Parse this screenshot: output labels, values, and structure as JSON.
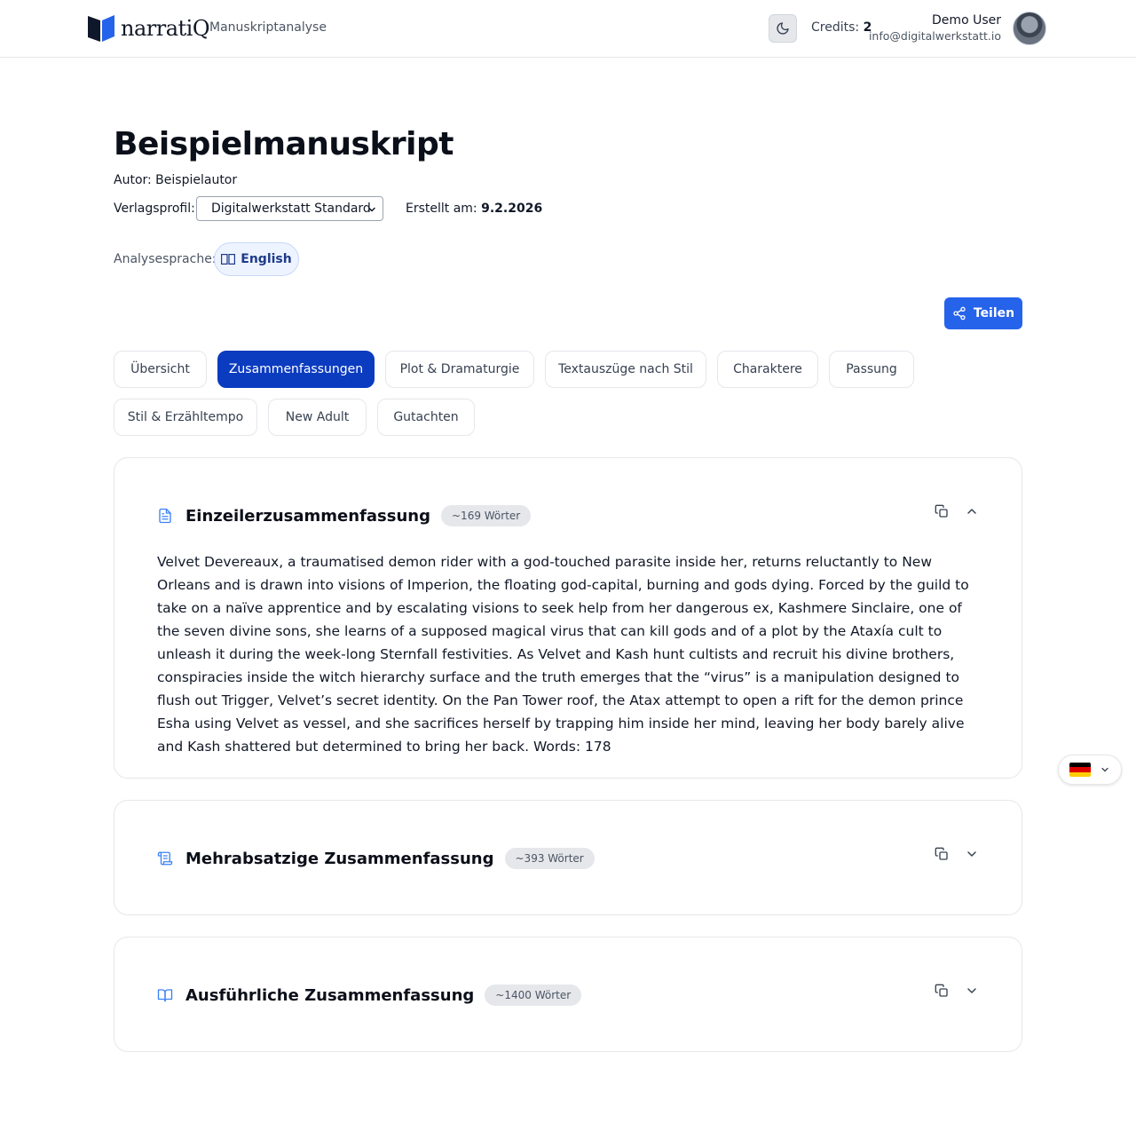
{
  "header": {
    "brand": "narratiQ",
    "subtitle": "Manuskriptanalyse",
    "credits_label": "Credits:",
    "credits_value": "2",
    "user_name": "Demo User",
    "user_email": "info@digitalwerkstatt.io"
  },
  "manuscript": {
    "title": "Beispielmanuskript",
    "author_line": "Autor: Beispielautor",
    "profile_label": "Verlagsprofil:",
    "profile_value": "Digitalwerkstatt Standard",
    "created_label": "Erstellt am:",
    "created_value": "9.2.2026",
    "language_label": "Analysesprache:",
    "language_value": "English"
  },
  "actions": {
    "share_label": "Teilen"
  },
  "tabs": [
    {
      "label": "Übersicht",
      "active": false
    },
    {
      "label": "Zusammenfassungen",
      "active": true
    },
    {
      "label": "Plot & Dramaturgie",
      "active": false
    },
    {
      "label": "Textauszüge nach Stil",
      "active": false
    },
    {
      "label": "Charaktere",
      "active": false
    },
    {
      "label": "Passung",
      "active": false
    },
    {
      "label": "Stil & Erzähltempo",
      "active": false
    },
    {
      "label": "New Adult",
      "active": false
    },
    {
      "label": "Gutachten",
      "active": false
    }
  ],
  "summaries": [
    {
      "title": "Einzeilerzusammenfassung",
      "badge": "~169 Wörter",
      "expanded": true,
      "text": "Velvet Devereaux, a traumatised demon rider with a god-touched parasite inside her, returns reluctantly to New Orleans and is drawn into visions of Imperion, the floating god-capital, burning and gods dying. Forced by the guild to take on a naïve apprentice and by escalating visions to seek help from her dangerous ex, Kashmere Sinclaire, one of the seven divine sons, she learns of a supposed magical virus that can kill gods and of a plot by the Ataxía cult to unleash it during the week-long Sternfall festivities. As Velvet and Kash hunt cultists and recruit his divine brothers, conspiracies inside the witch hierarchy surface and the truth emerges that the “virus” is a manipulation designed to flush out Trigger, Velvet’s secret identity. On the Pan Tower roof, the Atax attempt to open a rift for the demon prince Esha using Velvet as vessel, and she sacrifices herself by trapping him inside her mind, leaving her body barely alive and Kash shattered but determined to bring her back. Words: 178"
    },
    {
      "title": "Mehrabsatzige Zusammenfassung",
      "badge": "~393 Wörter",
      "expanded": false
    },
    {
      "title": "Ausführliche Zusammenfassung",
      "badge": "~1400 Wörter",
      "expanded": false
    }
  ],
  "colors": {
    "accent": "#2563eb",
    "active_tab": "#0b3bbf",
    "border": "#e5e7eb",
    "badge_bg": "#e5e7eb"
  }
}
